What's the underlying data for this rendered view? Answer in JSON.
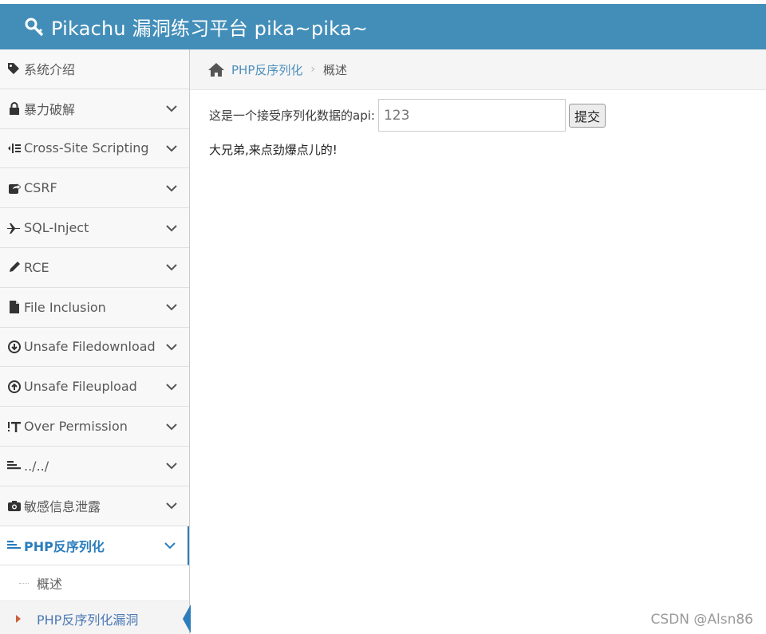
{
  "header": {
    "title": "Pikachu 漏洞练习平台 pika~pika~"
  },
  "sidebar": {
    "items": [
      {
        "label": "系统介绍",
        "icon": "tags-icon"
      },
      {
        "label": "暴力破解",
        "icon": "lock-icon"
      },
      {
        "label": "Cross-Site Scripting",
        "icon": "indent-icon"
      },
      {
        "label": "CSRF",
        "icon": "share-icon"
      },
      {
        "label": "SQL-Inject",
        "icon": "plane-icon"
      },
      {
        "label": "RCE",
        "icon": "pencil-icon"
      },
      {
        "label": "File Inclusion",
        "icon": "file-icon"
      },
      {
        "label": "Unsafe Filedownload",
        "icon": "download-icon"
      },
      {
        "label": "Unsafe Fileupload",
        "icon": "upload-icon"
      },
      {
        "label": "Over Permission",
        "icon": "text-height-icon"
      },
      {
        "label": "../../",
        "icon": "align-left-icon"
      },
      {
        "label": "敏感信息泄露",
        "icon": "camera-icon"
      },
      {
        "label": "PHP反序列化",
        "icon": "align-left-icon"
      }
    ],
    "sub_items": [
      {
        "label": "概述"
      },
      {
        "label": "PHP反序列化漏洞"
      }
    ]
  },
  "breadcrumb": {
    "link": "PHP反序列化",
    "current": "概述"
  },
  "main": {
    "prompt": "这是一个接受序列化数据的api:",
    "input_placeholder": "123",
    "submit_label": "提交",
    "message": "大兄弟,来点劲爆点儿的!"
  },
  "watermark": "CSDN @Alsn86",
  "colors": {
    "header_bg": "#438eb9",
    "active": "#2b7dbc",
    "link": "#4c8fbd"
  }
}
